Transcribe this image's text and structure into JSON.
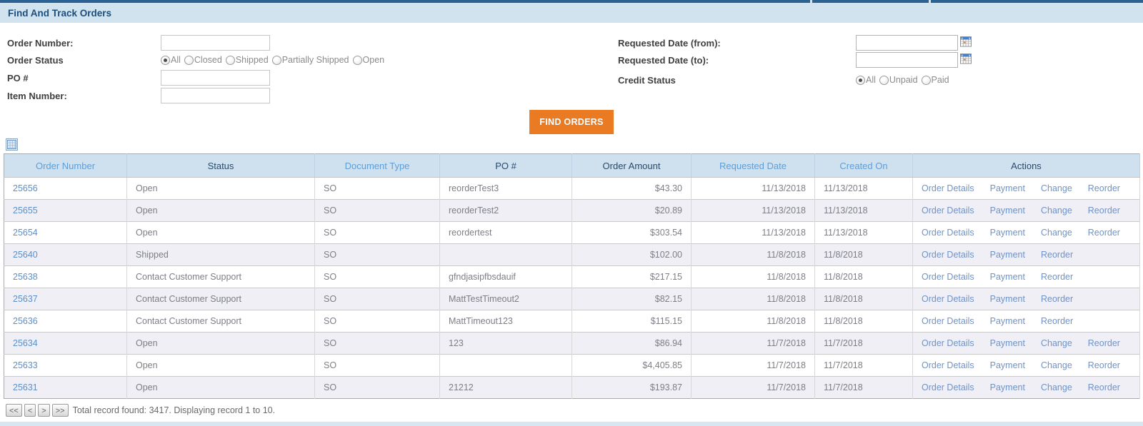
{
  "page": {
    "title": "Find And Track Orders"
  },
  "colors": {
    "accent_orange": "#EA7B22",
    "band_blue": "#D2E3F0",
    "header_link_blue": "#5F9ED6",
    "cell_link_blue": "#5C90C9",
    "top_bar_blue": "#2C6193"
  },
  "filters": {
    "order_number": {
      "label": "Order Number:",
      "value": ""
    },
    "order_status": {
      "label": "Order Status",
      "options": [
        "All",
        "Closed",
        "Shipped",
        "Partially Shipped",
        "Open"
      ],
      "selected": "All"
    },
    "po_number": {
      "label": "PO #",
      "value": ""
    },
    "item_number": {
      "label": "Item Number:",
      "value": ""
    },
    "requested_from": {
      "label": "Requested Date (from):",
      "value": ""
    },
    "requested_to": {
      "label": "Requested Date (to):",
      "value": ""
    },
    "credit_status": {
      "label": "Credit Status",
      "options": [
        "All",
        "Unpaid",
        "Paid"
      ],
      "selected": "All"
    },
    "find_button": "FIND ORDERS",
    "calendar_icon": "calendar-icon",
    "export_icon": "export-grid-icon"
  },
  "table": {
    "columns": [
      {
        "label": "Order Number",
        "link": true
      },
      {
        "label": "Status",
        "link": false
      },
      {
        "label": "Document Type",
        "link": true
      },
      {
        "label": "PO #",
        "link": false
      },
      {
        "label": "Order Amount",
        "link": false
      },
      {
        "label": "Requested Date",
        "link": true
      },
      {
        "label": "Created On",
        "link": true
      },
      {
        "label": "Actions",
        "link": false
      }
    ],
    "rows": [
      {
        "order_number": "25656",
        "status": "Open",
        "doc_type": "SO",
        "po": "reorderTest3",
        "amount": "$43.30",
        "requested": "11/13/2018",
        "created": "11/13/2018",
        "actions": [
          "Order Details",
          "Payment",
          "Change",
          "Reorder"
        ]
      },
      {
        "order_number": "25655",
        "status": "Open",
        "doc_type": "SO",
        "po": "reorderTest2",
        "amount": "$20.89",
        "requested": "11/13/2018",
        "created": "11/13/2018",
        "actions": [
          "Order Details",
          "Payment",
          "Change",
          "Reorder"
        ]
      },
      {
        "order_number": "25654",
        "status": "Open",
        "doc_type": "SO",
        "po": "reordertest",
        "amount": "$303.54",
        "requested": "11/13/2018",
        "created": "11/13/2018",
        "actions": [
          "Order Details",
          "Payment",
          "Change",
          "Reorder"
        ]
      },
      {
        "order_number": "25640",
        "status": "Shipped",
        "doc_type": "SO",
        "po": "",
        "amount": "$102.00",
        "requested": "11/8/2018",
        "created": "11/8/2018",
        "actions": [
          "Order Details",
          "Payment",
          "Reorder"
        ]
      },
      {
        "order_number": "25638",
        "status": "Contact Customer Support",
        "doc_type": "SO",
        "po": "gfndjasipfbsdauif",
        "amount": "$217.15",
        "requested": "11/8/2018",
        "created": "11/8/2018",
        "actions": [
          "Order Details",
          "Payment",
          "Reorder"
        ]
      },
      {
        "order_number": "25637",
        "status": "Contact Customer Support",
        "doc_type": "SO",
        "po": "MattTestTimeout2",
        "amount": "$82.15",
        "requested": "11/8/2018",
        "created": "11/8/2018",
        "actions": [
          "Order Details",
          "Payment",
          "Reorder"
        ]
      },
      {
        "order_number": "25636",
        "status": "Contact Customer Support",
        "doc_type": "SO",
        "po": "MattTimeout123",
        "amount": "$115.15",
        "requested": "11/8/2018",
        "created": "11/8/2018",
        "actions": [
          "Order Details",
          "Payment",
          "Reorder"
        ]
      },
      {
        "order_number": "25634",
        "status": "Open",
        "doc_type": "SO",
        "po": "123",
        "amount": "$86.94",
        "requested": "11/7/2018",
        "created": "11/7/2018",
        "actions": [
          "Order Details",
          "Payment",
          "Change",
          "Reorder"
        ]
      },
      {
        "order_number": "25633",
        "status": "Open",
        "doc_type": "SO",
        "po": "",
        "amount": "$4,405.85",
        "requested": "11/7/2018",
        "created": "11/7/2018",
        "actions": [
          "Order Details",
          "Payment",
          "Change",
          "Reorder"
        ]
      },
      {
        "order_number": "25631",
        "status": "Open",
        "doc_type": "SO",
        "po": "21212",
        "amount": "$193.87",
        "requested": "11/7/2018",
        "created": "11/7/2018",
        "actions": [
          "Order Details",
          "Payment",
          "Change",
          "Reorder"
        ]
      }
    ]
  },
  "pagination": {
    "first": "<<",
    "prev": "<",
    "next": ">",
    "last": ">>",
    "summary": "Total record found: 3417. Displaying record 1 to 10."
  }
}
